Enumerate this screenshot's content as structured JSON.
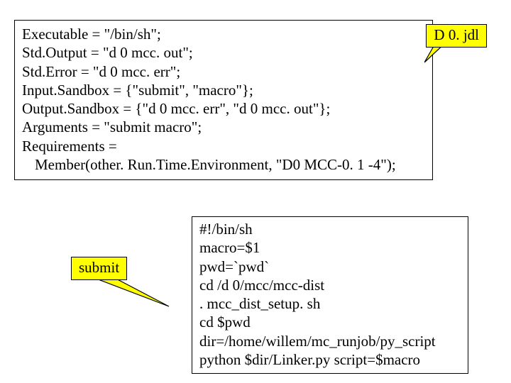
{
  "labels": {
    "jdl": "D 0. jdl",
    "submit": "submit"
  },
  "jdl": {
    "l1": "Executable = \"/bin/sh\";",
    "l2": "Std.Output = \"d 0 mcc. out\";",
    "l3": "Std.Error = \"d 0 mcc. err\";",
    "l4": "Input.Sandbox = {\"submit\", \"macro\"};",
    "l5": "Output.Sandbox = {\"d 0 mcc. err\", \"d 0 mcc. out\"};",
    "l6": "Arguments = \"submit macro\";",
    "l7": "Requirements =",
    "l8": "Member(other. Run.Time.Environment, \"D0 MCC-0. 1 -4\");"
  },
  "script": {
    "l1": "#!/bin/sh",
    "l2": "macro=$1",
    "l3": "pwd=`pwd`",
    "l4": "cd /d 0/mcc/mcc-dist",
    "l5": ". mcc_dist_setup. sh",
    "l6": "cd $pwd",
    "l7": "dir=/home/willem/mc_runjob/py_script",
    "l8": "python $dir/Linker.py script=$macro"
  }
}
